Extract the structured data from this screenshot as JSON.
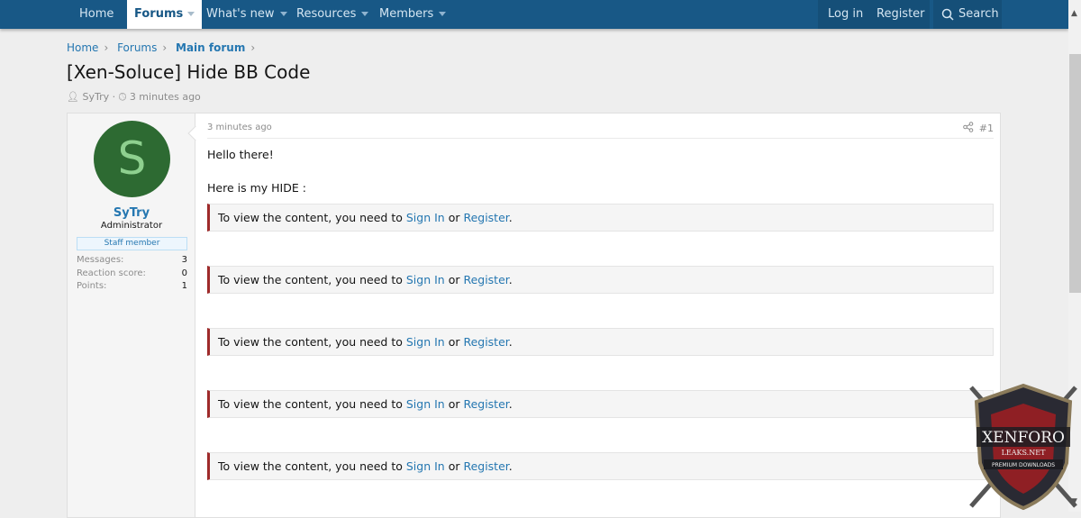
{
  "nav": {
    "home": "Home",
    "forums": "Forums",
    "whats_new": "What's new",
    "resources": "Resources",
    "members": "Members",
    "login": "Log in",
    "register": "Register",
    "search": "Search"
  },
  "breadcrumb": [
    "Home",
    "Forums",
    "Main forum"
  ],
  "thread": {
    "title": "[Xen-Soluce] Hide BB Code",
    "author": "SyTry",
    "time": "3 minutes ago"
  },
  "user": {
    "initial": "S",
    "name": "SyTry",
    "title": "Administrator",
    "badge": "Staff member",
    "stats": [
      {
        "label": "Messages:",
        "value": "3"
      },
      {
        "label": "Reaction score:",
        "value": "0"
      },
      {
        "label": "Points:",
        "value": "1"
      }
    ]
  },
  "post": {
    "time": "3 minutes ago",
    "number": "#1",
    "line1": "Hello there!",
    "line2": "Here is my HIDE :",
    "hide": {
      "prefix": "To view the content, you need to ",
      "sign_in": "Sign In",
      "or": " or ",
      "register": "Register",
      "suffix": "."
    }
  },
  "watermark": {
    "line1": "XENFORO",
    "line2": "LEAKS.NET",
    "line3": "PREMIUM DOWNLOADS"
  },
  "colors": {
    "nav": "#185886",
    "link": "#2577b1",
    "hide_border": "#9e2a2a",
    "avatar": "#2d6a32"
  }
}
